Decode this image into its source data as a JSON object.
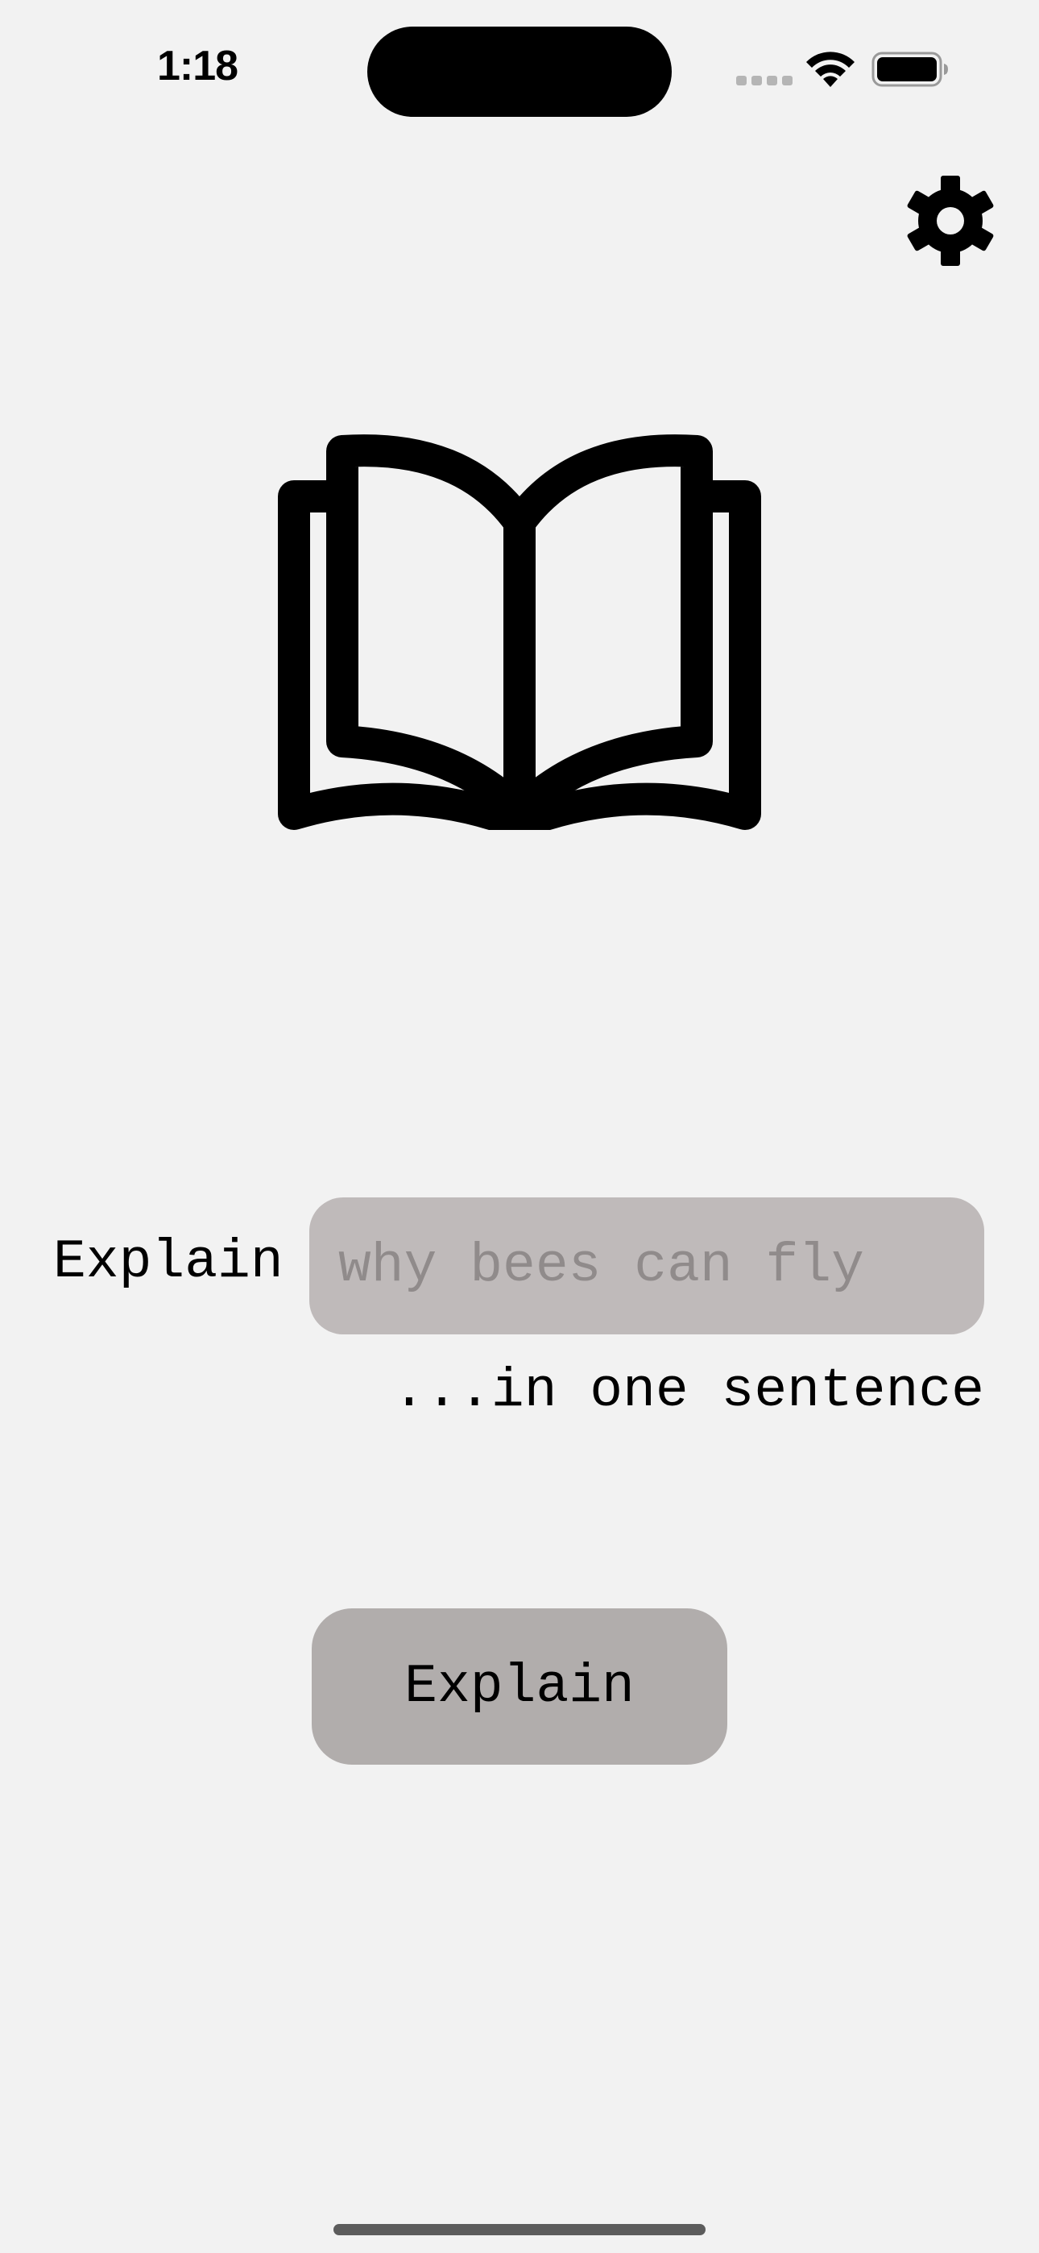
{
  "status_bar": {
    "time": "1:18",
    "cell_signal_icon": "cellular-signal-icon",
    "wifi_icon": "wifi-icon",
    "battery_icon": "battery-icon"
  },
  "header": {
    "settings_icon": "gear-icon"
  },
  "hero": {
    "icon": "open-book-icon"
  },
  "prompt": {
    "prefix_label": "Explain",
    "topic_placeholder": "why bees can fly",
    "topic_value": "",
    "suffix_label": "...in one sentence"
  },
  "actions": {
    "explain_label": "Explain"
  },
  "colors": {
    "background": "#f2f2f2",
    "input_fill": "#bfbaba",
    "placeholder_text": "#908b8b",
    "button_fill": "#b1adac",
    "foreground": "#000000"
  }
}
